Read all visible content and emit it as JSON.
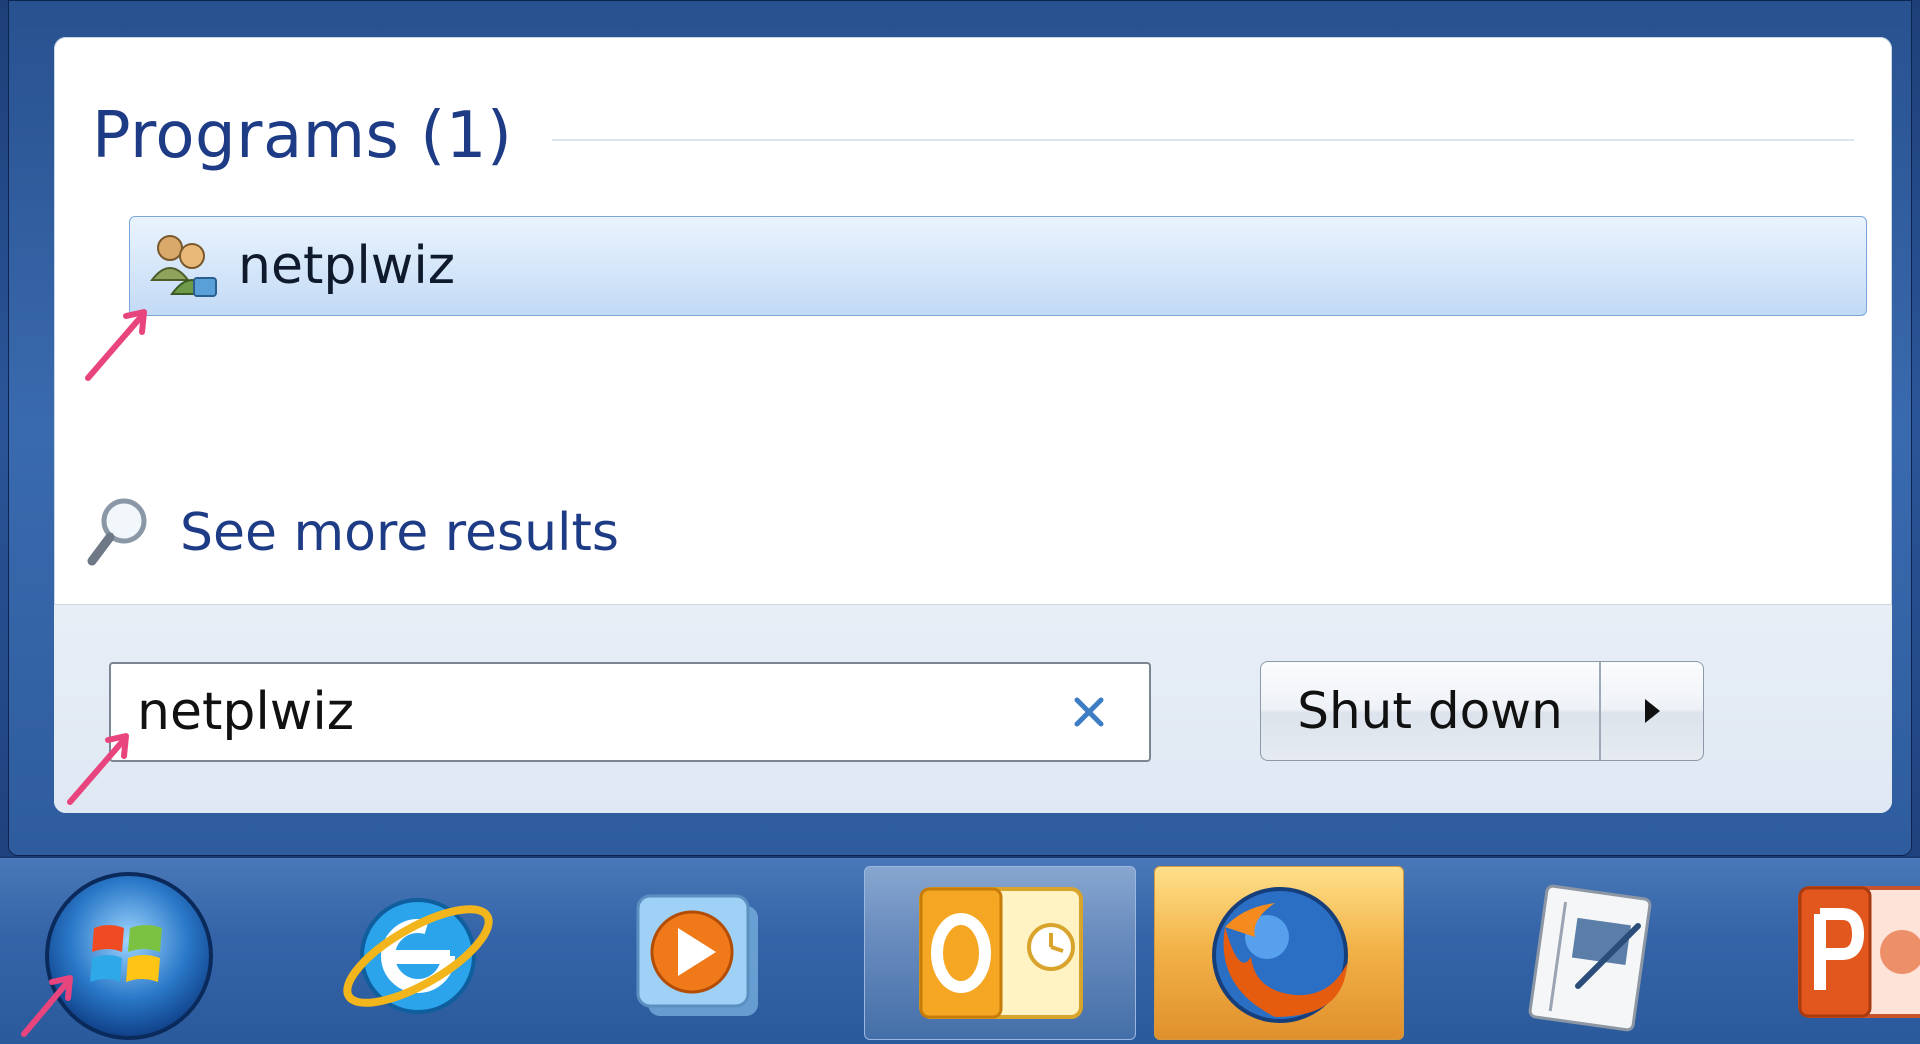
{
  "start_menu": {
    "section_title": "Programs (1)",
    "results": [
      {
        "label": "netplwiz",
        "icon": "user-accounts-icon"
      }
    ],
    "see_more_label": "See more results",
    "search": {
      "value": "netplwiz",
      "clear_icon": "clear-x-icon"
    },
    "shutdown_label": "Shut down",
    "shutdown_options_icon": "triangle-right-icon"
  },
  "taskbar": {
    "items": [
      {
        "name": "start-button",
        "icon": "windows-orb-icon"
      },
      {
        "name": "internet-explorer",
        "icon": "internet-explorer-icon"
      },
      {
        "name": "windows-media-player",
        "icon": "media-player-icon"
      },
      {
        "name": "outlook",
        "icon": "outlook-icon",
        "state": "active"
      },
      {
        "name": "firefox",
        "icon": "firefox-icon",
        "state": "highlighted"
      },
      {
        "name": "notepad-app",
        "icon": "notepad-icon"
      },
      {
        "name": "powerpoint",
        "icon": "powerpoint-icon"
      }
    ]
  },
  "colors": {
    "title_blue": "#1e3b86",
    "annotation_pink": "#e8457e",
    "selection_border": "#7aa7d9"
  }
}
